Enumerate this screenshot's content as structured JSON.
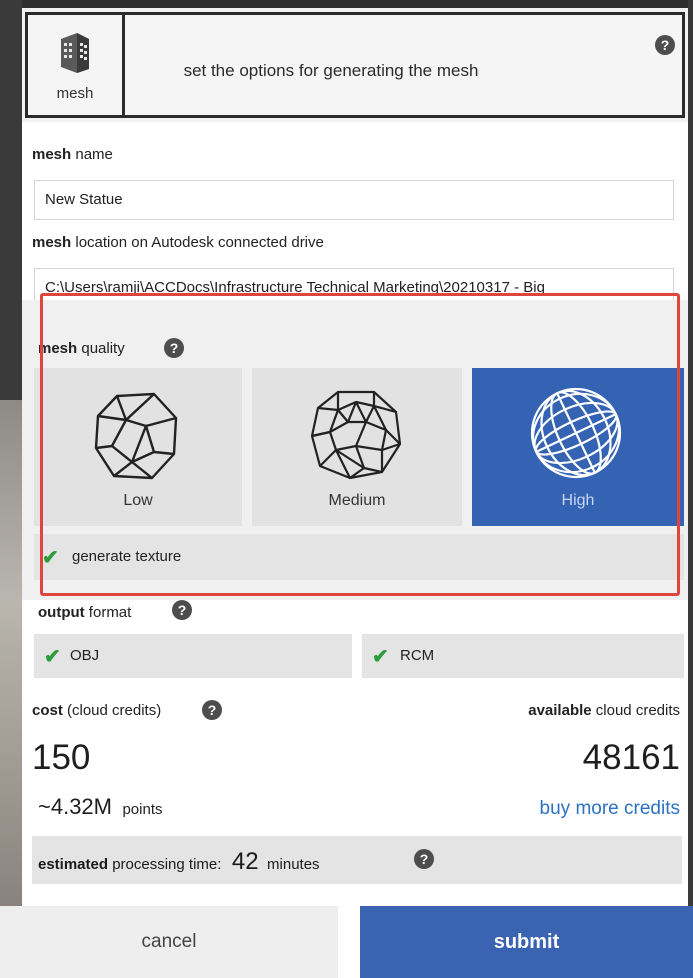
{
  "header": {
    "tab_label": "mesh",
    "title": "set the options for generating the mesh",
    "help": "?"
  },
  "mesh_name": {
    "label_bold": "mesh",
    "label_rest": " name",
    "value": "New Statue"
  },
  "mesh_location": {
    "label_bold": "mesh",
    "label_rest": " location on Autodesk connected drive",
    "value": "C:\\Users\\ramji\\ACCDocs\\Infrastructure Technical Marketing\\20210317 - Big"
  },
  "mesh_quality": {
    "label_bold": "mesh",
    "label_rest": " quality",
    "options": [
      {
        "label": "Low",
        "selected": false
      },
      {
        "label": "Medium",
        "selected": false
      },
      {
        "label": "High",
        "selected": true
      }
    ],
    "generate_texture": {
      "label": "generate texture",
      "checked": true
    }
  },
  "output_format": {
    "label_bold": "output",
    "label_rest": " format",
    "options": [
      {
        "label": "OBJ",
        "checked": true
      },
      {
        "label": "RCM",
        "checked": true
      }
    ]
  },
  "cost": {
    "label_bold": "cost",
    "label_rest": " (cloud credits)",
    "value": "150",
    "points_value": "~4.32M",
    "points_unit": "points"
  },
  "available": {
    "label_bold": "available",
    "label_rest": " cloud credits",
    "value": "48161",
    "buy_link": "buy more credits"
  },
  "processing": {
    "label_bold": "estimated",
    "label_rest": " processing time:",
    "value": "42",
    "unit": "minutes"
  },
  "footer": {
    "cancel": "cancel",
    "submit": "submit"
  },
  "colors": {
    "accent": "#3563b4",
    "highlight_border": "#e0453d",
    "check": "#2e9c3a",
    "link": "#2c72c2"
  }
}
